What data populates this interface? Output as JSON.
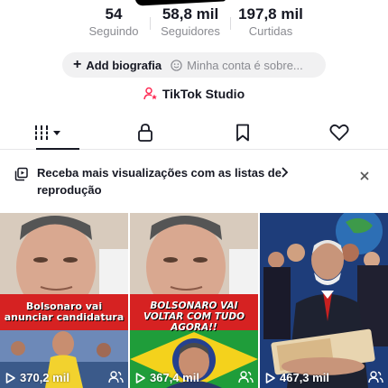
{
  "stats": [
    {
      "value": "54",
      "label": "Seguindo"
    },
    {
      "value": "58,8 mil",
      "label": "Seguidores"
    },
    {
      "value": "197,8 mil",
      "label": "Curtidas"
    }
  ],
  "bio": {
    "add_label": "Add biografia",
    "status_label": "Minha conta é sobre..."
  },
  "studio": {
    "label": "TikTok Studio",
    "icon": "person-star-icon"
  },
  "tabs": [
    {
      "name": "videos",
      "icon": "grid-dropdown-icon",
      "active": true
    },
    {
      "name": "private",
      "icon": "lock-icon",
      "active": false
    },
    {
      "name": "favorites",
      "icon": "bookmark-icon",
      "active": false
    },
    {
      "name": "liked",
      "icon": "heart-icon",
      "active": false
    }
  ],
  "banner": {
    "text": "Receba mais visualizações com as listas de reprodução",
    "icon": "playlist-icon",
    "arrow": "chevron-right-icon",
    "close": "close-icon"
  },
  "videos": [
    {
      "caption": "Bolsonaro vai anunciar candidatura",
      "views": "370,2 mil"
    },
    {
      "caption": "BOLSONARO VAI VOLTAR COM TUDO AGORA!!",
      "views": "367,4 mil"
    },
    {
      "caption": "",
      "views": "467,3 mil"
    }
  ],
  "colors": {
    "accent": "#fe2c55",
    "text": "#161823",
    "muted": "#8a8b91",
    "caption_red": "#d62222"
  }
}
